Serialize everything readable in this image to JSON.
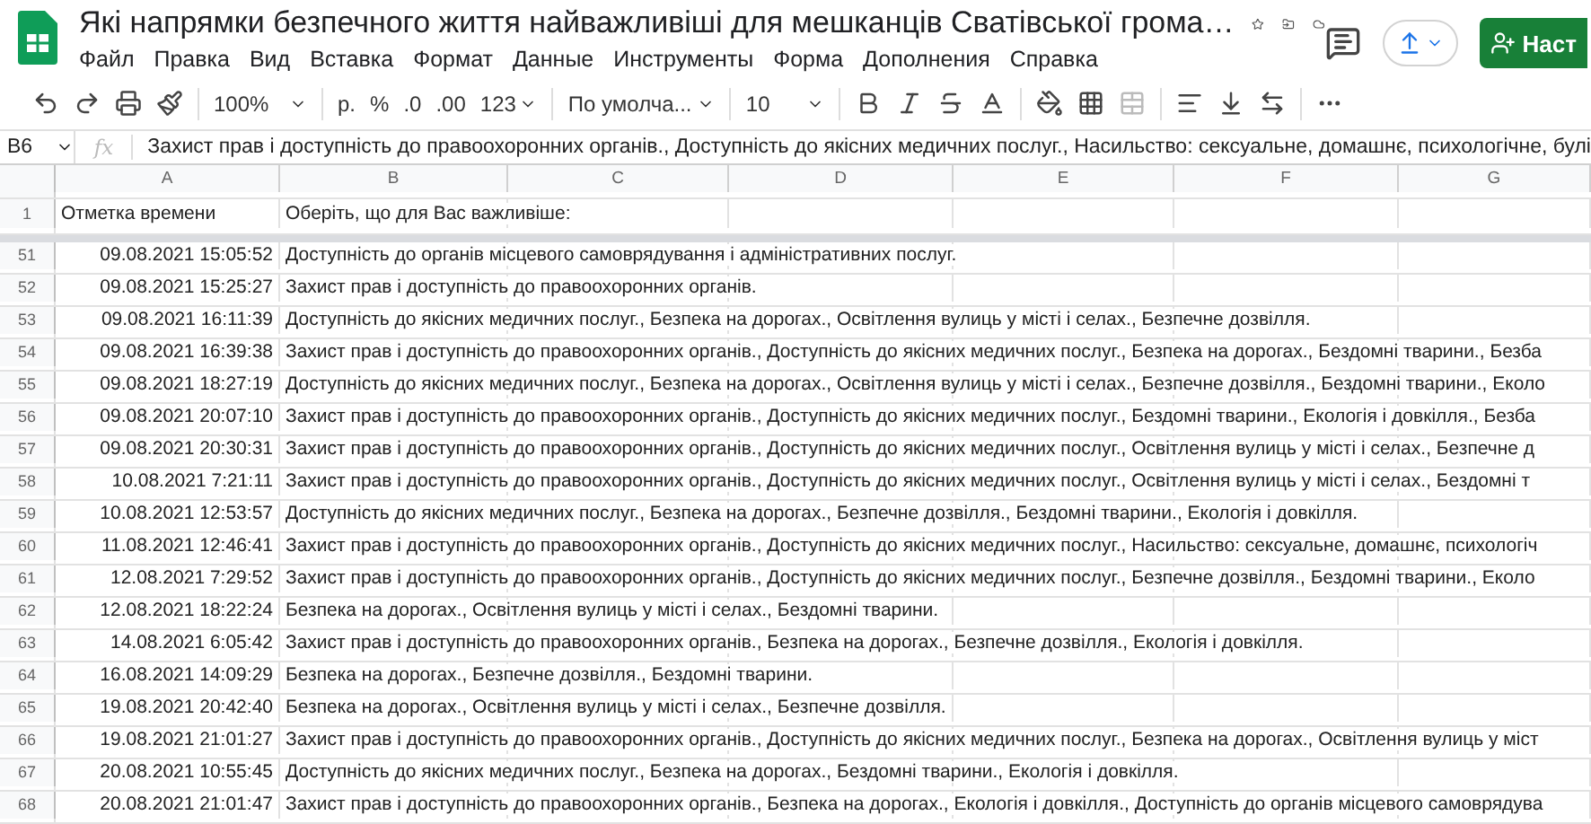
{
  "window": {
    "title": "Які напрямки безпечного життя найважливіші для мешканців Сватівської грома…",
    "share_button": "Наст"
  },
  "menu": [
    "Файл",
    "Правка",
    "Вид",
    "Вставка",
    "Формат",
    "Данные",
    "Инструменты",
    "Форма",
    "Дополнения",
    "Справка"
  ],
  "toolbar": {
    "zoom": "100%",
    "currency": "р.",
    "percent": "%",
    "decrease_decimals": ".0",
    "increase_decimals": ".00",
    "number_format": "123",
    "font": "По умолча...",
    "font_size": "10"
  },
  "formula_bar": {
    "name_box": "B6",
    "fx": "fx",
    "value": "Захист прав і доступність до правоохоронних органів., Доступність до якісних медичних послуг., Насильство: сексуальне, домашнє, психологічне, булі"
  },
  "columns": [
    "A",
    "B",
    "C",
    "D",
    "E",
    "F",
    "G"
  ],
  "header_row": {
    "row": "1",
    "timestamp": "Отметка времени",
    "answer": "Оберіть, що для Вас важливіше:"
  },
  "rows": [
    {
      "row": "51",
      "timestamp": "09.08.2021 15:05:52",
      "answer": "Доступність до органів місцевого самоврядування і адміністративних послуг."
    },
    {
      "row": "52",
      "timestamp": "09.08.2021 15:25:27",
      "answer": "Захист прав і доступність до правоохоронних органів."
    },
    {
      "row": "53",
      "timestamp": "09.08.2021 16:11:39",
      "answer": "Доступність до якісних медичних послуг., Безпека на дорогах., Освітлення вулиць у місті і селах., Безпечне дозвілля."
    },
    {
      "row": "54",
      "timestamp": "09.08.2021 16:39:38",
      "answer": "Захист прав і доступність до правоохоронних органів., Доступність до якісних медичних послуг., Безпека на дорогах., Бездомні тварини., Безба"
    },
    {
      "row": "55",
      "timestamp": "09.08.2021 18:27:19",
      "answer": "Доступність до якісних медичних послуг., Безпека на дорогах., Освітлення вулиць у місті і селах., Безпечне дозвілля., Бездомні тварини., Еколо"
    },
    {
      "row": "56",
      "timestamp": "09.08.2021 20:07:10",
      "answer": "Захист прав і доступність до правоохоронних органів., Доступність до якісних медичних послуг., Бездомні тварини., Екологія і довкілля., Безба"
    },
    {
      "row": "57",
      "timestamp": "09.08.2021 20:30:31",
      "answer": "Захист прав і доступність до правоохоронних органів., Доступність до якісних медичних послуг., Освітлення вулиць у місті і селах., Безпечне д"
    },
    {
      "row": "58",
      "timestamp": "10.08.2021 7:21:11",
      "answer": "Захист прав і доступність до правоохоронних органів., Доступність до якісних медичних послуг., Освітлення вулиць у місті і селах., Бездомні т"
    },
    {
      "row": "59",
      "timestamp": "10.08.2021 12:53:57",
      "answer": "Доступність до якісних медичних послуг., Безпека на дорогах., Безпечне дозвілля., Бездомні тварини., Екологія і довкілля."
    },
    {
      "row": "60",
      "timestamp": "11.08.2021 12:46:41",
      "answer": "Захист прав і доступність до правоохоронних органів., Доступність до якісних медичних послуг., Насильство: сексуальне, домашнє, психологіч"
    },
    {
      "row": "61",
      "timestamp": "12.08.2021 7:29:52",
      "answer": "Захист прав і доступність до правоохоронних органів., Доступність до якісних медичних послуг., Безпечне дозвілля., Бездомні тварини., Еколо"
    },
    {
      "row": "62",
      "timestamp": "12.08.2021 18:22:24",
      "answer": "Безпека на дорогах., Освітлення вулиць у місті і селах., Бездомні тварини."
    },
    {
      "row": "63",
      "timestamp": "14.08.2021 6:05:42",
      "answer": "Захист прав і доступність до правоохоронних органів., Безпека на дорогах., Безпечне дозвілля., Екологія і довкілля."
    },
    {
      "row": "64",
      "timestamp": "16.08.2021 14:09:29",
      "answer": "Безпека на дорогах., Безпечне дозвілля., Бездомні тварини."
    },
    {
      "row": "65",
      "timestamp": "19.08.2021 20:42:40",
      "answer": "Безпека на дорогах., Освітлення вулиць у місті і селах., Безпечне дозвілля."
    },
    {
      "row": "66",
      "timestamp": "19.08.2021 21:01:27",
      "answer": "Захист прав і доступність до правоохоронних органів., Доступність до якісних медичних послуг., Безпека на дорогах., Освітлення вулиць у міст"
    },
    {
      "row": "67",
      "timestamp": "20.08.2021 10:55:45",
      "answer": "Доступність до якісних медичних послуг., Безпека на дорогах., Бездомні тварини., Екологія і довкілля."
    },
    {
      "row": "68",
      "timestamp": "20.08.2021 21:01:47",
      "answer": "Захист прав і доступність до правоохоронних органів., Безпека на дорогах., Екологія і довкілля., Доступність до органів місцевого самоврядува"
    }
  ]
}
